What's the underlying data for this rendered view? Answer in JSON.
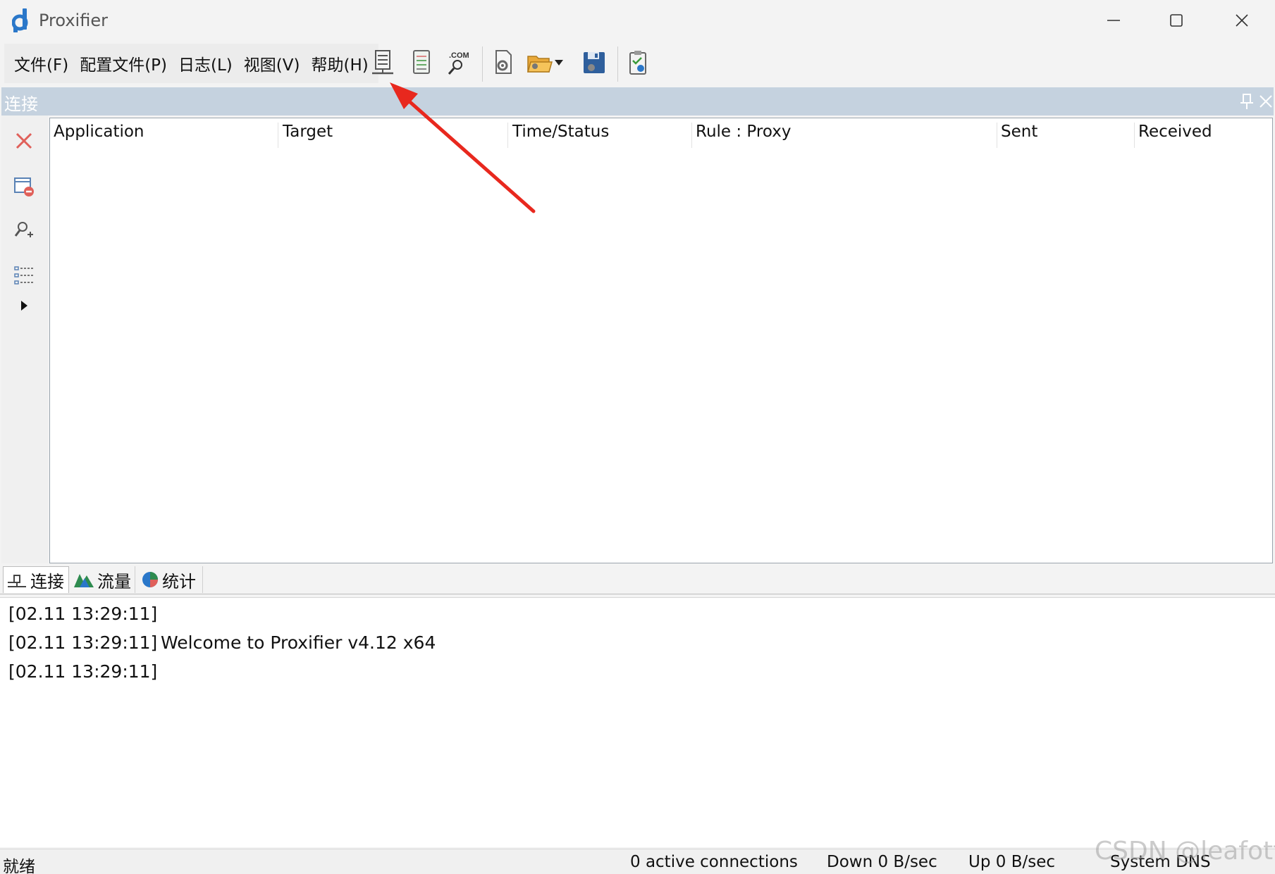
{
  "window": {
    "title": "Proxifier",
    "controls": [
      "minimize-icon",
      "maximize-icon",
      "close-icon"
    ]
  },
  "menu": {
    "items": [
      "文件(F)",
      "配置文件(P)",
      "日志(L)",
      "视图(V)",
      "帮助(H)"
    ]
  },
  "toolbar": {
    "icons": [
      "proxy-servers-icon",
      "proxification-rules-icon",
      "name-resolution-icon",
      "advanced-settings-icon",
      "open-profile-icon",
      "dropdown-arrow-icon",
      "save-profile-icon",
      "check-proxy-icon"
    ]
  },
  "panel": {
    "title": "连接"
  },
  "side_toolbar": {
    "icons": [
      "close-connection-icon",
      "remove-window-icon",
      "find-user-icon",
      "list-details-icon",
      "expand-arrow-icon"
    ]
  },
  "table": {
    "columns": [
      "Application",
      "Target",
      "Time/Status",
      "Rule : Proxy",
      "Sent",
      "Received"
    ],
    "rows": []
  },
  "tabs": [
    {
      "label": "连接",
      "icon": "connections-icon",
      "active": true
    },
    {
      "label": "流量",
      "icon": "traffic-icon",
      "active": false
    },
    {
      "label": "统计",
      "icon": "statistics-pie-icon",
      "active": false
    }
  ],
  "log": [
    {
      "timestamp": "[02.11 13:29:11]",
      "message": ""
    },
    {
      "timestamp": "[02.11 13:29:11]",
      "message": "Welcome to Proxifier v4.12 x64"
    },
    {
      "timestamp": "[02.11 13:29:11]",
      "message": ""
    }
  ],
  "status": {
    "ready": "就绪",
    "connections": "0 active connections",
    "down": "Down 0 B/sec",
    "up": "Up 0 B/sec",
    "dns": "System DNS"
  },
  "watermark": "CSDN @leafotto",
  "colors": {
    "panel_header": "#c5d2df",
    "annotation_arrow": "#e8281e",
    "background": "#f3f3f3"
  }
}
